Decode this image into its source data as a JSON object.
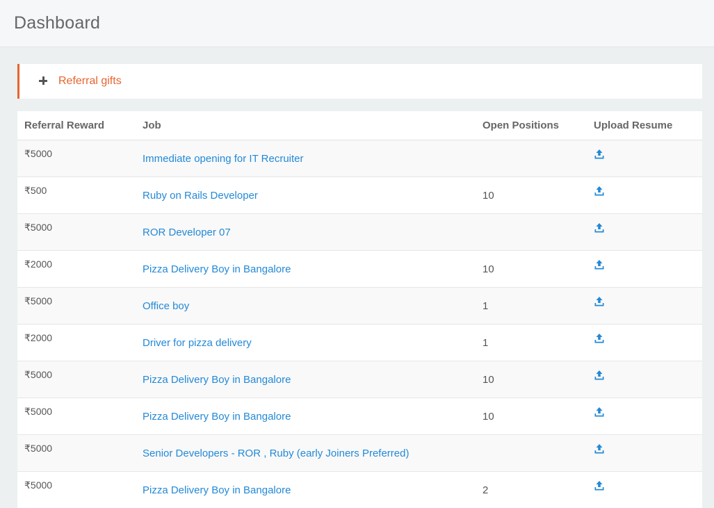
{
  "header": {
    "title": "Dashboard"
  },
  "panel": {
    "title": "Referral gifts"
  },
  "table": {
    "columns": [
      "Referral Reward",
      "Job",
      "Open Positions",
      "Upload Resume"
    ],
    "rows": [
      {
        "reward": "₹5000",
        "job": "Immediate opening for IT Recruiter",
        "open": ""
      },
      {
        "reward": "₹500",
        "job": "Ruby on Rails Developer",
        "open": "10"
      },
      {
        "reward": "₹5000",
        "job": "ROR Developer 07",
        "open": ""
      },
      {
        "reward": "₹2000",
        "job": "Pizza Delivery Boy in Bangalore",
        "open": "10"
      },
      {
        "reward": "₹5000",
        "job": "Office boy",
        "open": "1"
      },
      {
        "reward": "₹2000",
        "job": "Driver for pizza delivery",
        "open": "1"
      },
      {
        "reward": "₹5000",
        "job": "Pizza Delivery Boy in Bangalore",
        "open": "10"
      },
      {
        "reward": "₹5000",
        "job": "Pizza Delivery Boy in Bangalore",
        "open": "10"
      },
      {
        "reward": "₹5000",
        "job": "Senior Developers - ROR , Ruby (early Joiners Preferred)",
        "open": ""
      },
      {
        "reward": "₹5000",
        "job": "Pizza Delivery Boy in Bangalore",
        "open": "2"
      }
    ],
    "upload_icon": "upload-icon"
  },
  "colors": {
    "accent": "#e8632f",
    "link": "#2389d7"
  }
}
